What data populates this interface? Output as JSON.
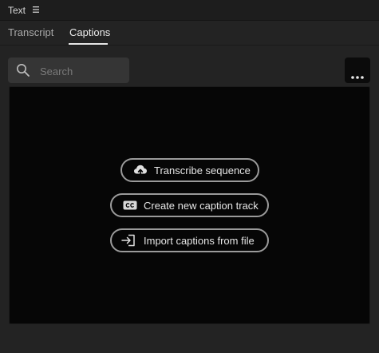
{
  "panel": {
    "title": "Text"
  },
  "tabs": [
    {
      "label": "Transcript",
      "active": false
    },
    {
      "label": "Captions",
      "active": true
    }
  ],
  "search": {
    "placeholder": "Search",
    "value": ""
  },
  "actions": {
    "transcribe_label": "Transcribe sequence",
    "create_caption_label": "Create new caption track",
    "import_captions_label": "Import captions from file"
  },
  "icons": {
    "panel_menu": "hamburger-menu-icon",
    "search": "search-icon",
    "more": "ellipsis-icon",
    "transcribe": "cloud-upload-icon",
    "create_caption": "closed-caption-icon",
    "import": "import-icon"
  },
  "colors": {
    "panel_bg": "#232323",
    "header_bg": "#1d1d1d",
    "captions_area_bg": "#060606",
    "button_border": "#9a9a9a",
    "active_tab_text": "#ececec",
    "inactive_tab_text": "#a9a9a9"
  }
}
